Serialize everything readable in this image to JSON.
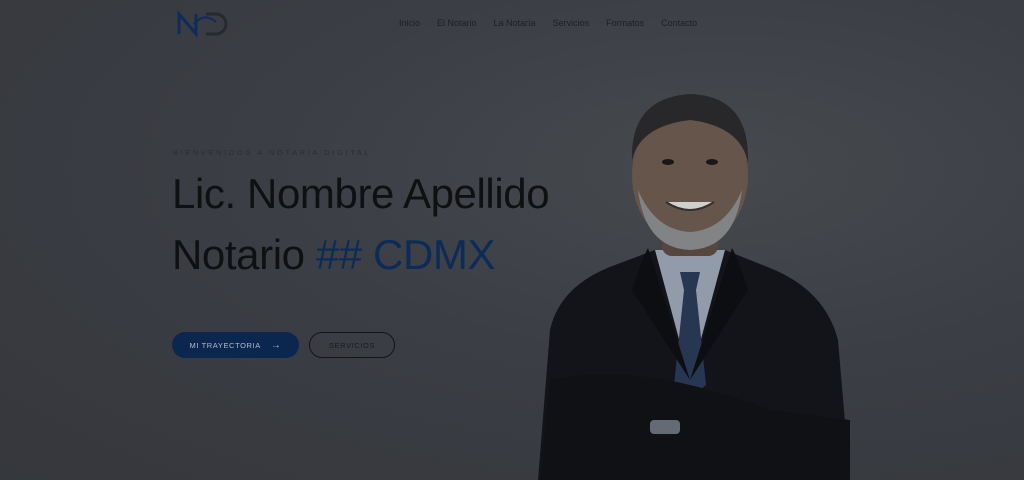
{
  "header": {
    "logo_alt": "ND",
    "nav": [
      "Inicio",
      "El Notario",
      "La Notaría",
      "Servicios",
      "Formatos",
      "Contacto"
    ]
  },
  "hero": {
    "kicker": "BIENVENIDOS A NOTARIA DIGITAL",
    "title_line1": "Lic. Nombre Apellido",
    "title_line2_prefix": "Notario",
    "title_line2_accent": "## CDMX",
    "primary_button": "MI TRAYECTORIA",
    "secondary_button": "SERVICIOS"
  },
  "colors": {
    "accent": "#0d2e5c",
    "background": "#3d4046"
  }
}
